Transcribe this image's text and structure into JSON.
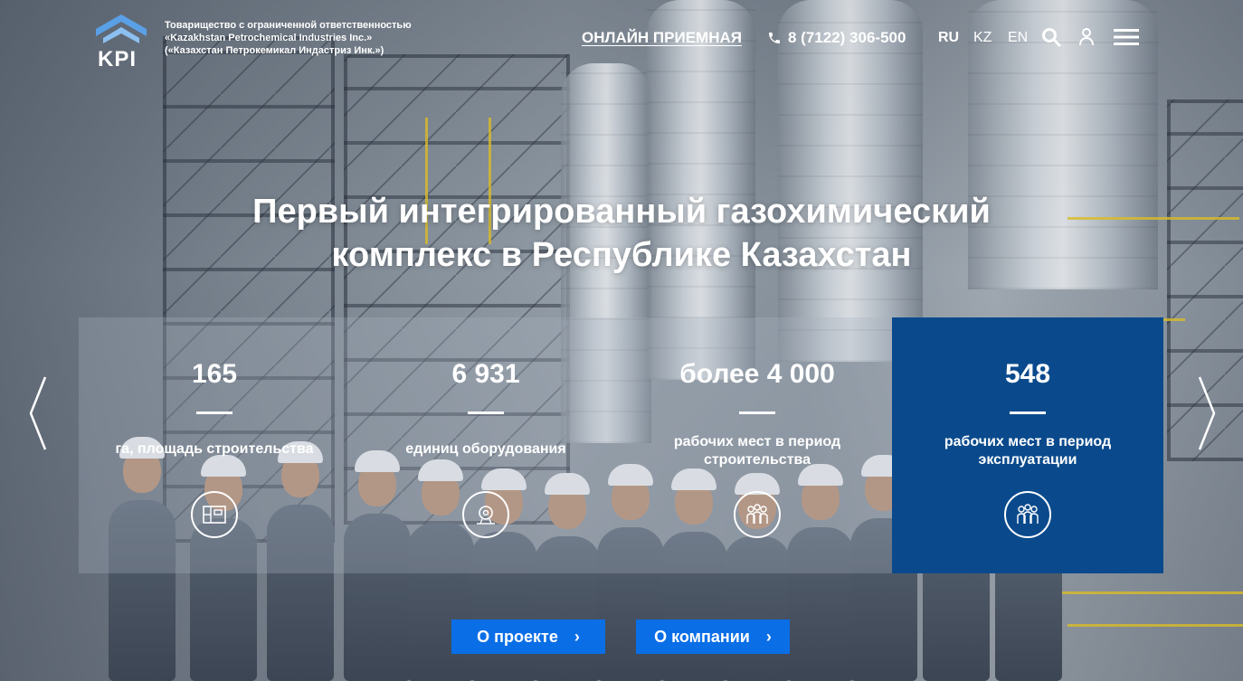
{
  "header": {
    "logo_text": "KPI",
    "company_lines": [
      "Товарищество с ограниченной ответственностью",
      "«Kazakhstan Petrochemical Industries Inc.»",
      "(«Казахстан Петрокемикал Индастриз Инк.»)"
    ],
    "online_reception": "ОНЛАЙН ПРИЕМНАЯ",
    "phone": "8 (7122) 306-500",
    "languages": [
      "RU",
      "KZ",
      "EN"
    ],
    "icons": [
      "phone-icon",
      "search-icon",
      "accessibility-icon",
      "menu-icon"
    ]
  },
  "hero": {
    "title_line1": "Первый интегрированный газохимический",
    "title_line2": "комплекс в Республике Казахстан"
  },
  "stats": [
    {
      "value": "165",
      "label": "га, площадь строительства",
      "icon": "site-plan-icon"
    },
    {
      "value": "6 931",
      "label": "единиц оборудования",
      "icon": "equipment-icon"
    },
    {
      "value": "более 4 000",
      "label": "рабочих мест в период строительства",
      "icon": "workers-icon"
    },
    {
      "value": "548",
      "label": "рабочих мест в период эксплуатации",
      "icon": "workers-icon"
    }
  ],
  "buttons": {
    "about_project": "О проекте",
    "about_company": "О компании",
    "chevron": "›"
  },
  "colors": {
    "accent_blue": "#0a6ee6",
    "active_card": "#0a4a8c",
    "logo_blue": "#5aa0e6"
  }
}
